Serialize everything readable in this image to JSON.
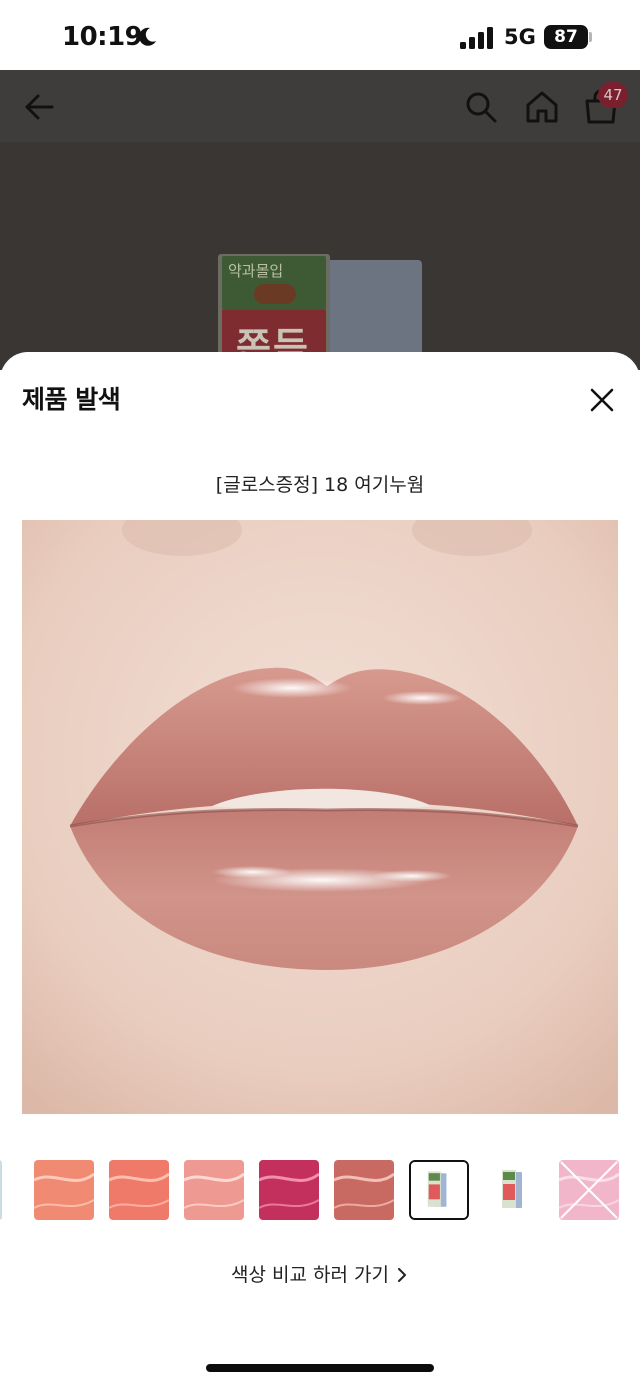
{
  "status_bar": {
    "time": "10:19",
    "network": "5G",
    "battery": "87"
  },
  "header": {
    "cart_count": "47",
    "icons": [
      "back-arrow-icon",
      "search-icon",
      "home-icon",
      "cart-icon"
    ]
  },
  "product_box": {
    "top_text": "약과몰입",
    "main_text": "쫀득"
  },
  "sheet": {
    "title": "제품 발색",
    "shade_name": "[글로스증정] 18 여기누웜",
    "compare_link": "색상 비교 하러 가기"
  },
  "swatches": [
    {
      "color": "#f08a72",
      "highlight": "#ffd2c2",
      "selected": false,
      "type": "gloss"
    },
    {
      "color": "#f07a6a",
      "highlight": "#ffc6b8",
      "selected": false,
      "type": "gloss"
    },
    {
      "color": "#ee9a92",
      "highlight": "#ffe0da",
      "selected": false,
      "type": "gloss"
    },
    {
      "color": "#c4305e",
      "highlight": "#f59ab8",
      "selected": false,
      "type": "gloss"
    },
    {
      "color": "#c86a62",
      "highlight": "#f6c8c0",
      "selected": false,
      "type": "gloss"
    },
    {
      "color": "#ffffff",
      "highlight": "#ffffff",
      "selected": true,
      "type": "product"
    },
    {
      "color": "#ffffff",
      "highlight": "#ffffff",
      "selected": false,
      "type": "product"
    },
    {
      "color": "#f2b6ca",
      "highlight": "#fbe3ec",
      "selected": false,
      "type": "crossed"
    }
  ],
  "colors": {
    "lip": "#c8837a",
    "skin": "#edd3c6",
    "dim_overlay": "#3a3634"
  }
}
